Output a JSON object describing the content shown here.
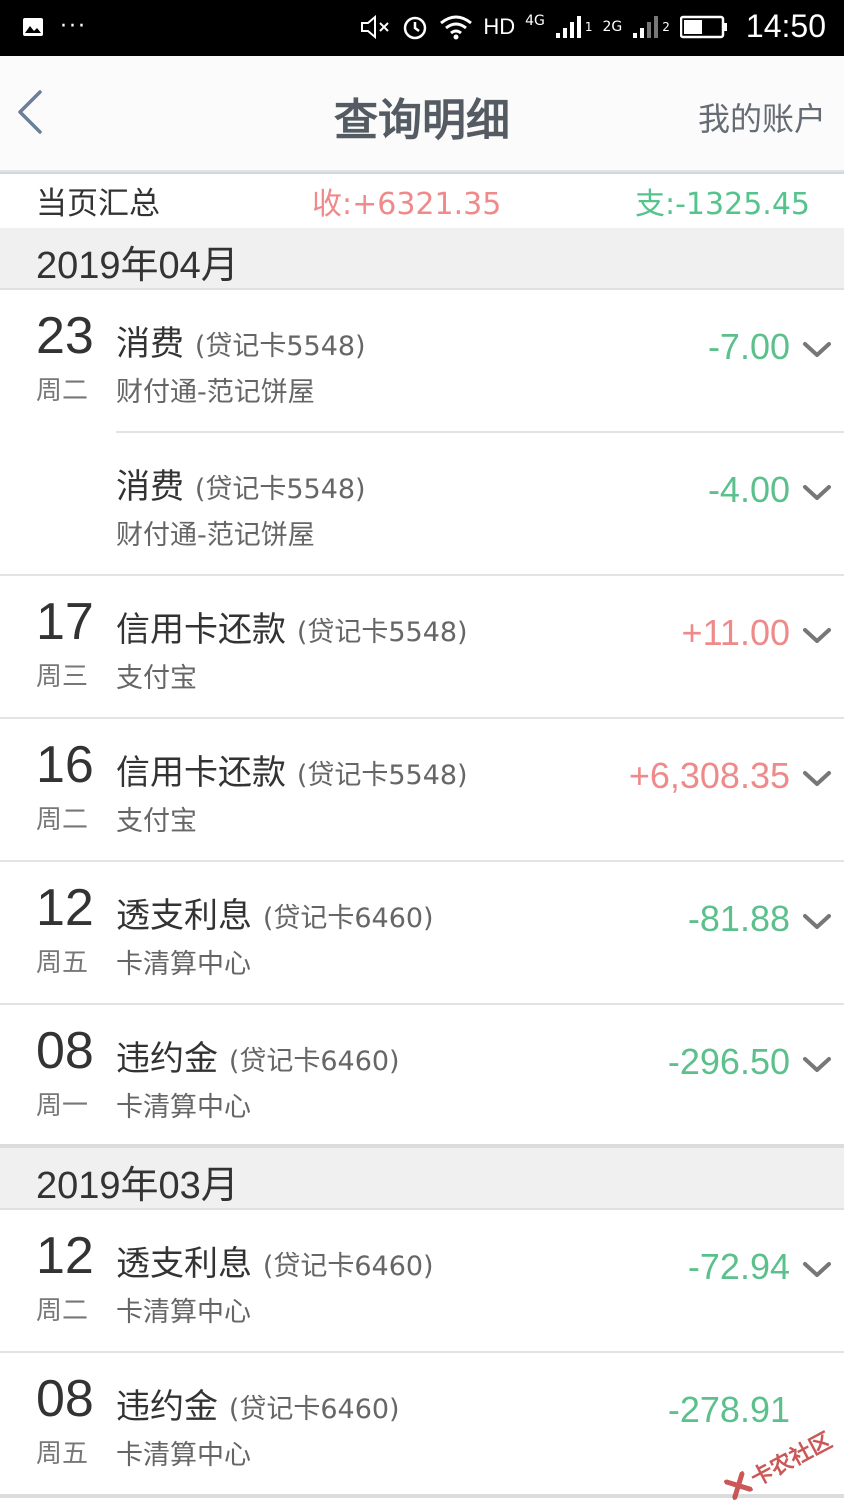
{
  "status_bar": {
    "network_hd": "HD",
    "network_4g": "4G",
    "sim1": "1",
    "network_2g": "2G",
    "sim2": "2",
    "time": "14:50"
  },
  "nav": {
    "title": "查询明细",
    "account_link": "我的账户"
  },
  "summary": {
    "label": "当页汇总",
    "income": "收:+6321.35",
    "expense": "支:-1325.45"
  },
  "months": [
    {
      "label": "2019年04月",
      "rows": [
        {
          "day": "23",
          "weekday": "周二",
          "type": "消费",
          "card": "(贷记卡5548)",
          "merchant": "财付通-范记饼屋",
          "amount": "-7.00"
        },
        {
          "day": "",
          "weekday": "",
          "type": "消费",
          "card": "(贷记卡5548)",
          "merchant": "财付通-范记饼屋",
          "amount": "-4.00"
        },
        {
          "day": "17",
          "weekday": "周三",
          "type": "信用卡还款",
          "card": "(贷记卡5548)",
          "merchant": "支付宝",
          "amount": "+11.00"
        },
        {
          "day": "16",
          "weekday": "周二",
          "type": "信用卡还款",
          "card": "(贷记卡5548)",
          "merchant": "支付宝",
          "amount": "+6,308.35"
        },
        {
          "day": "12",
          "weekday": "周五",
          "type": "透支利息",
          "card": "(贷记卡6460)",
          "merchant": "卡清算中心",
          "amount": "-81.88"
        },
        {
          "day": "08",
          "weekday": "周一",
          "type": "违约金",
          "card": "(贷记卡6460)",
          "merchant": "卡清算中心",
          "amount": "-296.50"
        }
      ]
    },
    {
      "label": "2019年03月",
      "rows": [
        {
          "day": "12",
          "weekday": "周二",
          "type": "透支利息",
          "card": "(贷记卡6460)",
          "merchant": "卡清算中心",
          "amount": "-72.94"
        },
        {
          "day": "08",
          "weekday": "周五",
          "type": "违约金",
          "card": "(贷记卡6460)",
          "merchant": "卡清算中心",
          "amount": "-278.91"
        }
      ]
    }
  ],
  "watermark": "卡农社区",
  "colors": {
    "income": "#ef8a8a",
    "expense": "#5cc08c",
    "status_bar": "#000000"
  }
}
